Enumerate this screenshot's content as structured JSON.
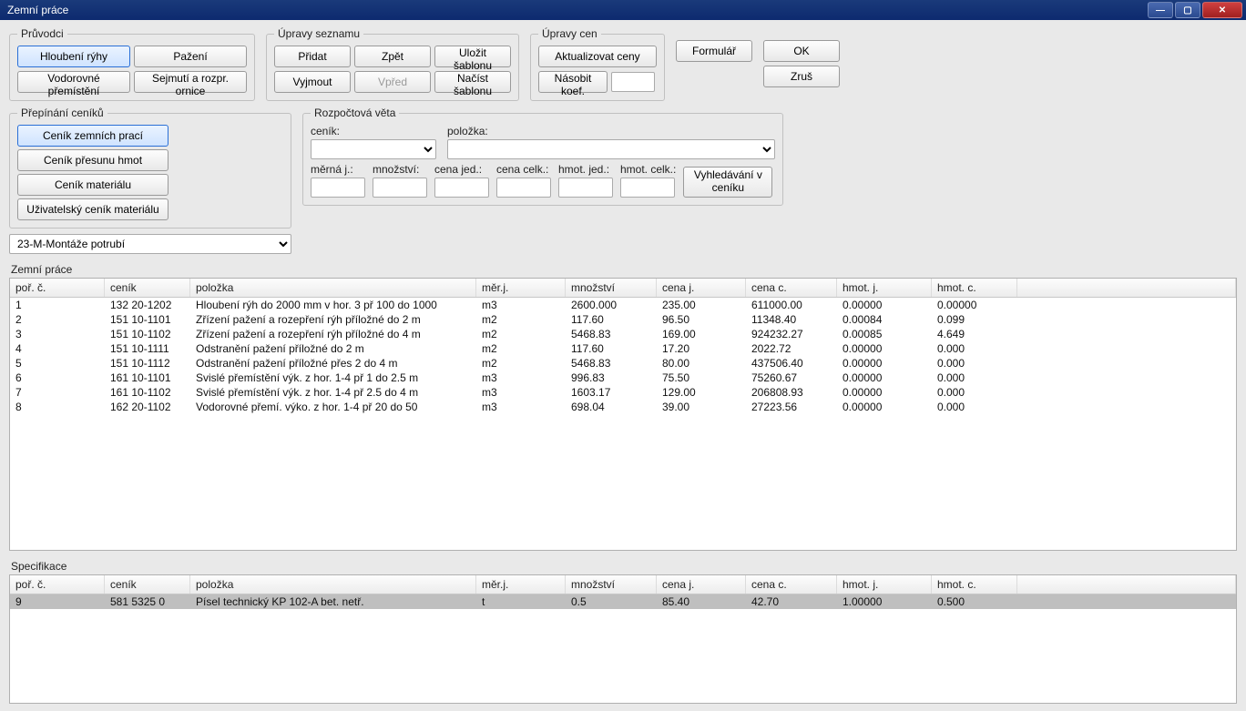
{
  "window": {
    "title": "Zemní práce"
  },
  "groups": {
    "pruvodci": {
      "legend": "Průvodci",
      "hloubeni": "Hloubení rýhy",
      "pazeni": "Pažení",
      "vodorovne": "Vodorovné přemístění",
      "sejmuti": "Sejmutí a rozpr. ornice"
    },
    "upravy_seznamu": {
      "legend": "Úpravy seznamu",
      "pridat": "Přidat",
      "zpet": "Zpět",
      "ulozit": "Uložit šablonu",
      "vyjmout": "Vyjmout",
      "vpred": "Vpřed",
      "nacist": "Načíst šablonu"
    },
    "upravy_cen": {
      "legend": "Úpravy cen",
      "aktualizovat": "Aktualizovat ceny",
      "nasobit": "Násobit koef.",
      "koef_value": ""
    },
    "formular": "Formulář",
    "ok": "OK",
    "zrus": "Zruš"
  },
  "ceniky": {
    "legend": "Přepínání ceníků",
    "zemnich": "Ceník zemních prací",
    "presunu": "Ceník přesunu hmot",
    "materialu": "Ceník materiálu",
    "uzivatelsky": "Uživatelský ceník materiálu"
  },
  "rozvet": {
    "legend": "Rozpočtová věta",
    "lbl_cenik": "ceník:",
    "lbl_polozka": "položka:",
    "lbl_merna": "měrná j.:",
    "lbl_mnozstvi": "množství:",
    "lbl_cena_jed": "cena jed.:",
    "lbl_cena_celk": "cena celk.:",
    "lbl_hmot_jed": "hmot. jed.:",
    "lbl_hmot_celk": "hmot. celk.:",
    "vyhledavani": "Vyhledávání v ceníku"
  },
  "montaze_combo": "23-M-Montáže potrubí",
  "tables": {
    "main_label": "Zemní práce",
    "spec_label": "Specifikace",
    "headers": {
      "por": "poř. č.",
      "cenik": "ceník",
      "polozka": "položka",
      "mj": "měr.j.",
      "mn": "množství",
      "cj": "cena j.",
      "cc": "cena c.",
      "hj": "hmot. j.",
      "hc": "hmot. c."
    },
    "main_rows": [
      {
        "por": "1",
        "cenik": "132 20-1202",
        "polozka": "Hloubení rýh do 2000 mm v hor. 3 př 100 do 1000",
        "mj": "m3",
        "mn": "2600.000",
        "cj": "235.00",
        "cc": "611000.00",
        "hj": "0.00000",
        "hc": "0.00000"
      },
      {
        "por": "2",
        "cenik": "151 10-1101",
        "polozka": "Zřízení pažení a rozepření rýh příložné do 2 m",
        "mj": "m2",
        "mn": "117.60",
        "cj": "96.50",
        "cc": "11348.40",
        "hj": "0.00084",
        "hc": "0.099"
      },
      {
        "por": "3",
        "cenik": "151 10-1102",
        "polozka": "Zřízení pažení a rozepření rýh příložné do 4 m",
        "mj": "m2",
        "mn": "5468.83",
        "cj": "169.00",
        "cc": "924232.27",
        "hj": "0.00085",
        "hc": "4.649"
      },
      {
        "por": "4",
        "cenik": "151 10-1111",
        "polozka": "Odstranění pažení příložné do 2 m",
        "mj": "m2",
        "mn": "117.60",
        "cj": "17.20",
        "cc": "2022.72",
        "hj": "0.00000",
        "hc": "0.000"
      },
      {
        "por": "5",
        "cenik": "151 10-1112",
        "polozka": "Odstranění pažení příložné přes 2 do 4 m",
        "mj": "m2",
        "mn": "5468.83",
        "cj": "80.00",
        "cc": "437506.40",
        "hj": "0.00000",
        "hc": "0.000"
      },
      {
        "por": "6",
        "cenik": "161 10-1101",
        "polozka": "Svislé přemístění výk. z hor. 1-4 př 1 do 2.5 m",
        "mj": "m3",
        "mn": "996.83",
        "cj": "75.50",
        "cc": "75260.67",
        "hj": "0.00000",
        "hc": "0.000"
      },
      {
        "por": "7",
        "cenik": "161 10-1102",
        "polozka": "Svislé přemístění výk. z hor. 1-4 př 2.5 do 4 m",
        "mj": "m3",
        "mn": "1603.17",
        "cj": "129.00",
        "cc": "206808.93",
        "hj": "0.00000",
        "hc": "0.000"
      },
      {
        "por": "8",
        "cenik": "162 20-1102",
        "polozka": "Vodorovné přemí. výko. z hor. 1-4 př 20 do 50",
        "mj": "m3",
        "mn": "698.04",
        "cj": "39.00",
        "cc": "27223.56",
        "hj": "0.00000",
        "hc": "0.000"
      }
    ],
    "spec_rows": [
      {
        "por": "9",
        "cenik": "581 5325  0",
        "polozka": "Písel technický KP 102-A bet. netř.",
        "mj": "t",
        "mn": "0.5",
        "cj": "85.40",
        "cc": "42.70",
        "hj": "1.00000",
        "hc": "0.500"
      }
    ]
  }
}
